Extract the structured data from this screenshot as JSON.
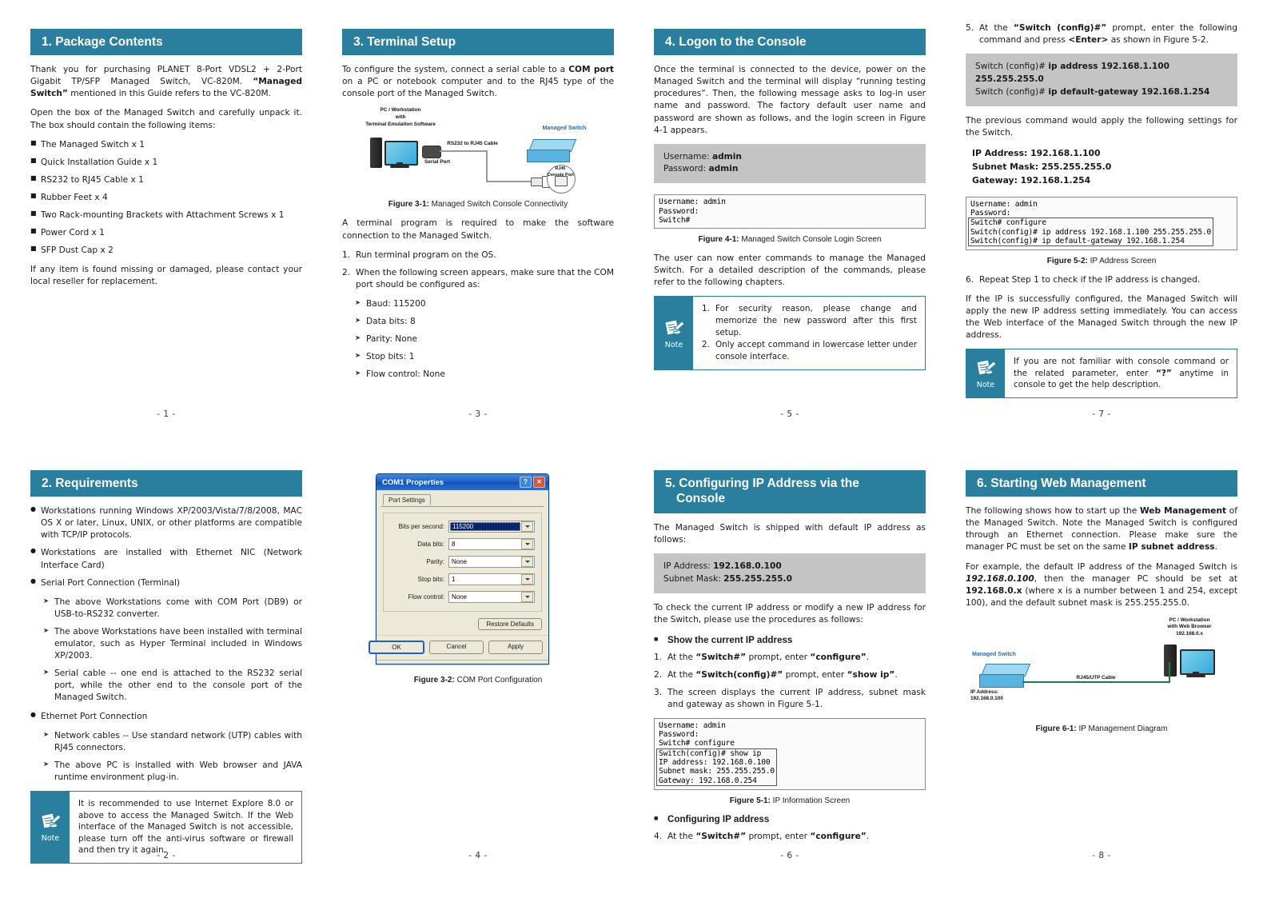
{
  "document": {
    "product": "PLANET 8-Port VDSL2 + 2-Port Gigabit TP/SFP Managed Switch, VC-820M"
  },
  "pages": {
    "n1": "- 1 -",
    "n2": "- 2 -",
    "n3": "- 3 -",
    "n4": "- 4 -",
    "n5": "- 5 -",
    "n6": "- 6 -",
    "n7": "- 7 -",
    "n8": "- 8 -"
  },
  "section1": {
    "heading": "1. Package Contents",
    "intro": "Thank you for purchasing PLANET 8-Port VDSL2 + 2-Port Gigabit TP/SFP Managed Switch, VC-820M. “Managed Switch” mentioned in this Guide refers to the VC-820M.",
    "intro_bold": "“Managed Switch”",
    "unpack": "Open the box of the Managed Switch and carefully unpack it. The box should contain the following items:",
    "items": [
      "The Managed Switch x 1",
      "Quick Installation Guide x 1",
      "RS232 to RJ45 Cable x 1",
      "Rubber Feet x 4",
      "Two Rack-mounting Brackets with Attachment Screws x 1",
      "Power Cord x 1",
      "SFP Dust Cap x 2"
    ],
    "closing": "If any item is found missing or damaged, please contact your local reseller for replacement."
  },
  "section2": {
    "heading": "2. Requirements",
    "bullets": [
      "Workstations running Windows XP/2003/Vista/7/8/2008, MAC OS X or later, Linux, UNIX, or other platforms are compatible with TCP/IP protocols.",
      "Workstations are installed with Ethernet NIC (Network Interface Card)",
      "Serial Port Connection (Terminal)",
      "Ethernet Port Connection"
    ],
    "serial_sub": [
      "The above Workstations come with COM Port (DB9) or USB-to-RS232 converter.",
      "The above Workstations have been installed with terminal emulator, such as Hyper Terminal included in Windows XP/2003.",
      "Serial cable -- one end is attached to the RS232 serial port, while the other end to the console port of the Managed Switch."
    ],
    "ethernet_sub": [
      "Network cables -- Use standard network (UTP) cables with RJ45 connectors.",
      "The above PC is installed with Web browser and JAVA runtime environment plug-in."
    ],
    "note": {
      "label": "Note",
      "text": "It is recommended to use Internet Explore 8.0 or above to access the Managed Switch. If the Web interface of the Managed Switch is not accessible, please turn off the anti-virus software or firewall and then try it again."
    }
  },
  "section3": {
    "heading": "3. Terminal Setup",
    "intro_a": "To configure the system, connect a serial cable to a ",
    "intro_bold": "COM port",
    "intro_b": " on a PC or notebook computer and to the RJ45 type of the console port of the Managed Switch.",
    "figure31": {
      "caption_label": "Figure 3-1:",
      "caption_text": "Managed Switch Console Connectivity",
      "pc_label": "PC / Workstation\nwith\nTerminal Emulation Software",
      "serial_label": "Serial Port",
      "cable_label": "RS232 to RJ45 Cable",
      "switch_label": "Managed Switch",
      "console_label": "RJ45\nConsole Port"
    },
    "after_fig": "A terminal program is required to make the software connection to the Managed Switch.",
    "steps": [
      "Run terminal program on the OS.",
      "When the following screen appears, make sure that the COM port should be configured as:"
    ],
    "params": [
      "Baud: 115200",
      "Data bits: 8",
      "Parity: None",
      "Stop bits: 1",
      "Flow control: None"
    ],
    "dialog": {
      "title": "COM1 Properties",
      "help_btn": "?",
      "close_btn": "✕",
      "tab": "Port Settings",
      "fields": [
        {
          "label": "Bits per second:",
          "value": "115200",
          "selected": true
        },
        {
          "label": "Data bits:",
          "value": "8",
          "selected": false
        },
        {
          "label": "Parity:",
          "value": "None",
          "selected": false
        },
        {
          "label": "Stop bits:",
          "value": "1",
          "selected": false
        },
        {
          "label": "Flow control:",
          "value": "None",
          "selected": false
        }
      ],
      "restore": "Restore Defaults",
      "ok": "OK",
      "cancel": "Cancel",
      "apply": "Apply"
    },
    "figure32": {
      "caption_label": "Figure 3-2:",
      "caption_text": "COM Port Configuration"
    }
  },
  "section4": {
    "heading": "4. Logon to the Console",
    "intro": "Once the terminal is connected to the device, power on the Managed Switch and the terminal will display “running testing procedures”. Then, the following message asks to log-in user name and password. The factory default user name and password are shown as follows, and the login screen in Figure 4-1 appears.",
    "credentials": {
      "username_label": "Username:",
      "username_value": "admin",
      "password_label": "Password:",
      "password_value": "admin"
    },
    "console41": "Username: admin\nPassword:\nSwitch#",
    "figure41": {
      "caption_label": "Figure 4-1:",
      "caption_text": "Managed Switch Console Login Screen"
    },
    "after": "The user can now enter commands to manage the Managed Switch. For a detailed description of the commands, please refer to the following chapters.",
    "note": {
      "label": "Note",
      "items": [
        "For security reason, please change and memorize the new password after this first setup.",
        "Only accept command in lowercase letter under console interface."
      ]
    }
  },
  "section5": {
    "heading_line1": "5. Configuring IP Address via the",
    "heading_line2": "Console",
    "intro": "The Managed Switch is shipped with default IP address as follows:",
    "defaults": {
      "ip_label": "IP Address:",
      "ip_value": "192.168.0.100",
      "mask_label": "Subnet Mask:",
      "mask_value": "255.255.255.0"
    },
    "procedures": "To check the current IP address or modify a new IP address for the Switch, please use the procedures as follows:",
    "subhead_show": "Show the current IP address",
    "steps_show": [
      "At the “Switch#” prompt, enter “configure”.",
      "At the “Switch(config)#” prompt, enter “show ip”.",
      "The screen displays the current IP address, subnet mask and gateway as shown in Figure 5-1."
    ],
    "console51_top": "Username: admin\nPassword:\nSwitch# configure",
    "console51_hl": "Switch(config)# show ip\nIP address: 192.168.0.100\nSubnet mask: 255.255.255.0\nGateway: 192.168.0.254",
    "figure51": {
      "caption_label": "Figure 5-1:",
      "caption_text": "IP Information Screen"
    },
    "subhead_config": "Configuring IP address",
    "step4": "At the “Switch#” prompt, enter “configure”.",
    "step5": "At the “Switch (config)#” prompt, enter the following command and press <Enter> as shown in Figure 5-2.",
    "commands": {
      "line1_prompt": "Switch (config)#",
      "line1_cmd": "ip address 192.168.1.100 255.255.255.0",
      "line2_prompt": "Switch (config)#",
      "line2_cmd": "ip default-gateway 192.168.1.254"
    },
    "apply_text": "The previous command would apply the following settings for the Switch.",
    "applied": [
      "IP Address: 192.168.1.100",
      "Subnet Mask: 255.255.255.0",
      "Gateway: 192.168.1.254"
    ],
    "console52_top": "Username: admin\nPassword:",
    "console52_hl": "Switch# configure\nSwitch(config)# ip address 192.168.1.100 255.255.255.0\nSwitch(config)# ip default-gateway 192.168.1.254",
    "figure52": {
      "caption_label": "Figure 5-2:",
      "caption_text": "IP Address Screen"
    },
    "step6": "Repeat Step 1 to check if the IP address is changed.",
    "closing": "If the IP is successfully configured, the Managed Switch will apply the new IP address setting immediately. You can access the Web interface of the Managed Switch through the new IP address.",
    "note": {
      "label": "Note",
      "text": "If you are not familiar with console command or the related parameter, enter “?” anytime in console to get the help description."
    }
  },
  "section6": {
    "heading": "6. Starting Web Management",
    "para1_a": "The following shows how to start up the ",
    "para1_bold": "Web Management",
    "para1_b": " of the Managed Switch. Note the Managed Switch is configured through an Ethernet connection. Please make sure the manager PC must be set on the same ",
    "para1_bold2": "IP subnet address",
    "para1_c": ".",
    "para2_a": "For example, the default IP address of the Managed Switch is ",
    "para2_ip": "192.168.0.100",
    "para2_b": ", then the manager PC should be set at ",
    "para2_ip2": "192.168.0.x",
    "para2_c": " (where x is a number between 1 and 254, except 100), and the default subnet mask is 255.255.255.0.",
    "figure61": {
      "caption_label": "Figure 6-1:",
      "caption_text": "IP Management Diagram",
      "switch_label": "Managed Switch",
      "switch_ip": "IP Address:\n192.168.0.100",
      "cable_label": "RJ45/UTP Cable",
      "pc_label": "PC / Workstation\nwith Web Browser\n192.168.0.x"
    }
  },
  "colors": {
    "accent": "#2a7f9e",
    "grey_box": "#c4c4c4",
    "switch_blue": "#5bb4e0",
    "cable_green": "#1e7a4d"
  }
}
